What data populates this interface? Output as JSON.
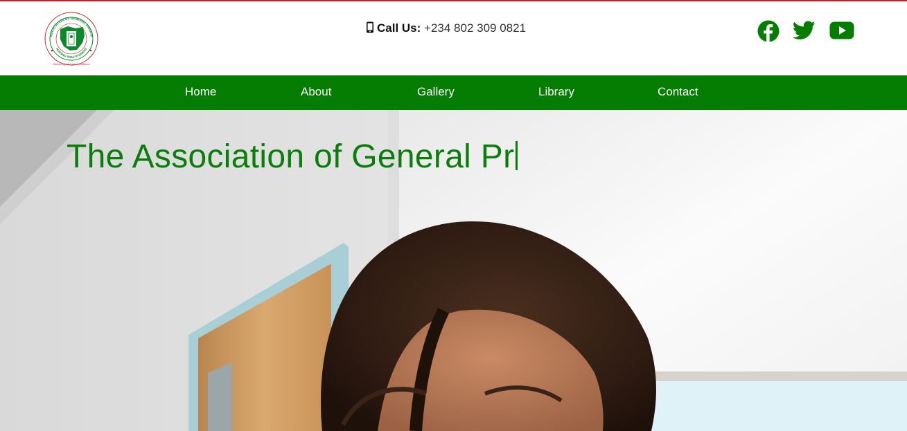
{
  "header": {
    "logo": {
      "ring_text_top": "ASSOCIATION OF GENERAL PRIVATE",
      "ring_text_bottom": "NURSING PRACTITIONERS",
      "motto": "Delivering care per excellence",
      "colors": {
        "green": "#0b8a2a",
        "red": "#c8202a"
      }
    },
    "call_label": "Call Us:",
    "phone": "+234 802 309 0821",
    "icons": [
      "phone-icon",
      "facebook-icon",
      "twitter-icon",
      "youtube-icon"
    ],
    "social_color": "#057d02"
  },
  "nav": {
    "background": "#057d02",
    "items": [
      {
        "label": "Home"
      },
      {
        "label": "About"
      },
      {
        "label": "Gallery"
      },
      {
        "label": "Library"
      },
      {
        "label": "Contact"
      }
    ]
  },
  "hero": {
    "headline": "The Association of General Pr",
    "headline_color": "#0b7d0b"
  }
}
